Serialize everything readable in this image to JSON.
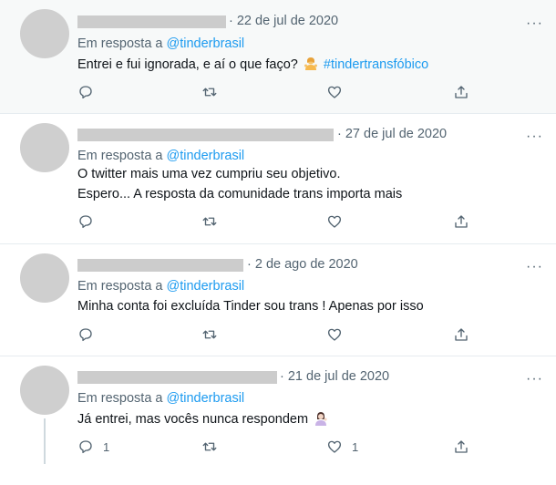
{
  "tweets": [
    {
      "date": "· 22 de jul de 2020",
      "reply_prefix": "Em resposta a ",
      "reply_handle": "@tinderbrasil",
      "lines": [
        "Entrei e fui ignorada, e aí o que faço?",
        "#tindertransfóbico"
      ],
      "emoji": "person-shrugging-emoji",
      "reply_count": "",
      "retweet_count": "",
      "like_count": ""
    },
    {
      "date": "· 27 de jul de 2020",
      "reply_prefix": "Em resposta a ",
      "reply_handle": "@tinderbrasil",
      "lines": [
        "O twitter mais uma vez cumpriu seu objetivo.",
        "Espero... A resposta da comunidade trans importa mais"
      ],
      "reply_count": "",
      "retweet_count": "",
      "like_count": ""
    },
    {
      "date": "· 2 de ago de 2020",
      "reply_prefix": "Em resposta a ",
      "reply_handle": "@tinderbrasil",
      "lines": [
        "Minha conta foi excluída Tinder sou trans ! Apenas por isso"
      ],
      "reply_count": "",
      "retweet_count": "",
      "like_count": ""
    },
    {
      "date": "· 21 de jul de 2020",
      "reply_prefix": "Em resposta a ",
      "reply_handle": "@tinderbrasil",
      "lines": [
        "Já entrei, mas vocês nunca respondem"
      ],
      "emoji": "woman-tipping-hand-emoji",
      "reply_count": "1",
      "retweet_count": "",
      "like_count": "1"
    }
  ],
  "more_label": "···",
  "colors": {
    "link": "#1d9bf0",
    "secondary": "#536471",
    "redaction": "#cccccc",
    "avatar": "#cfcfcf"
  },
  "icons": [
    "reply-icon",
    "retweet-icon",
    "like-icon",
    "share-icon",
    "more-icon"
  ]
}
